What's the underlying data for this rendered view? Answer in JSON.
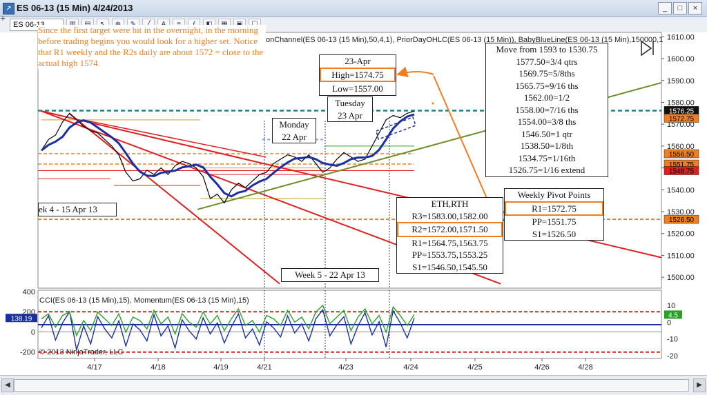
{
  "window": {
    "title": "ES 06-13 (15 Min)  4/24/2013",
    "minimize": "_",
    "maximize": "□",
    "close": "×",
    "restore": "❐"
  },
  "toolbar": {
    "instrument": "ES 06-13"
  },
  "indicator_label": "onChannel(ES 06-13 (15 Min),50,4,1), PriorDayOHLC(ES 06-13 (15 Min)), BabyBlueLine(ES 06-13 (15 Min),150000,1",
  "note": {
    "text": "Since the first target were hit in the overnight, in the morning before trading begins you would look for a higher set. Notice that R1 weekly and the R2s daily are about 1572 = close to the actual high 1574."
  },
  "box_23apr": {
    "date": "23-Apr",
    "high": "High=1574.75",
    "low": "Low=1557.00"
  },
  "box_tuesday": {
    "day": "Tuesday",
    "date": "23 Apr"
  },
  "box_monday": {
    "day": "Monday",
    "date": "22 Apr"
  },
  "box_week4": {
    "text": "ek 4 - 15 Apr 13"
  },
  "box_week5": {
    "text": "Week 5 - 22 Apr 13"
  },
  "box_move": {
    "title": "Move from 1593 to 1530.75",
    "rows": [
      "1577.50=3/4 qtrs",
      "1569.75=5/8ths",
      "1565.75=9/16 ths",
      "1562.00=1/2",
      "1558.00=7/16 ths",
      "1554.00=3/8 ths",
      "1546.50=1 qtr",
      "1538.50=1/8th",
      "1534.75=1/16th",
      "1526.75=1/16 extend"
    ]
  },
  "box_eth": {
    "title": "ETH,RTH",
    "rows": [
      "R3=1583.00,1582.00",
      "R2=1572.00,1571.50",
      "R1=1564.75,1563.75",
      "PP=1553.75,1553.25",
      "S1=1546.50,1545.50"
    ]
  },
  "box_weekly": {
    "title": "Weekly Pivot Points",
    "rows": [
      "R1=1572.75",
      "PP=1551.75",
      "S1=1526.50"
    ]
  },
  "indicator_title": "CCI(ES 06-13 (15 Min),15), Momentum(ES 06-13 (15 Min),15)",
  "copyright": "© 2013 NinjaTrader, LLC",
  "colors": {
    "price": "#000000",
    "channel": "#1a2fa0",
    "red": "#e02020",
    "orange": "#ef7e1f",
    "green": "#6d8f2a",
    "teal": "#1a8080",
    "cci": "#1a2fa0",
    "momentum": "#2aa02a"
  },
  "chart_data": {
    "type": "line",
    "instrument": "ES 06-13 (15 Min)",
    "price_axis": {
      "ticks": [
        "1610.00",
        "1600.00",
        "1590.00",
        "1580.00",
        "1570.00",
        "1560.00",
        "1550.00",
        "1540.00",
        "1530.00",
        "1520.00",
        "1510.00",
        "1500.00"
      ],
      "ylim": [
        1495,
        1612
      ]
    },
    "date_ticks": [
      "4/17",
      "4/18",
      "4/19",
      "4/21",
      "4/23",
      "4/24",
      "4/25",
      "4/26",
      "4/28"
    ],
    "price_markers": [
      {
        "label": "1576.25",
        "color": "#111111",
        "text_color": "#ffffff"
      },
      {
        "label": "1572.75",
        "color": "#ef7e1f",
        "text_color": "#000000"
      },
      {
        "label": "1556.50",
        "color": "#ef7e1f",
        "text_color": "#000000"
      },
      {
        "label": "1551.75",
        "color": "#ef7e1f",
        "text_color": "#000000"
      },
      {
        "label": "1548.75",
        "color": "#e02020",
        "text_color": "#000000"
      },
      {
        "label": "1526.50",
        "color": "#ef7e1f",
        "text_color": "#000000"
      }
    ],
    "price_series": [
      1558,
      1563,
      1565,
      1571,
      1575,
      1572,
      1569,
      1567,
      1566,
      1563,
      1560,
      1556,
      1548,
      1544,
      1545,
      1549,
      1547,
      1550,
      1547,
      1551,
      1553,
      1552,
      1550,
      1546,
      1536,
      1538,
      1534,
      1540,
      1543,
      1541,
      1544,
      1547,
      1548,
      1552,
      1554,
      1556,
      1555,
      1553,
      1556,
      1552,
      1548,
      1550,
      1554,
      1557,
      1555,
      1553,
      1554,
      1560,
      1566,
      1572,
      1574,
      1573,
      1575,
      1576
    ],
    "indicator_axis": {
      "left_ticks": [
        "400",
        "200",
        "0",
        "-200"
      ],
      "right_ticks": [
        "10",
        "0",
        "-10",
        "-20"
      ]
    },
    "indicator_markers": [
      {
        "label": "138.19"
      },
      {
        "label": "4.5"
      }
    ],
    "cci_series": [
      40,
      160,
      -80,
      90,
      200,
      -180,
      60,
      -120,
      150,
      30,
      -60,
      110,
      -140,
      80,
      20,
      -90,
      170,
      -40,
      60,
      -160,
      120,
      10,
      -70,
      140,
      -20,
      90,
      -110,
      50,
      180,
      -60,
      30,
      -130,
      100,
      40,
      -50,
      160,
      -10,
      80,
      -90,
      130,
      220,
      -40,
      70,
      150,
      -120,
      60,
      190,
      -30,
      100,
      -150,
      210,
      90,
      -60,
      138
    ],
    "momentum_series": [
      2,
      5,
      -3,
      4,
      6,
      -8,
      1,
      -5,
      6,
      2,
      -2,
      5,
      -6,
      3,
      1,
      -4,
      7,
      -1,
      3,
      -7,
      5,
      0,
      -3,
      6,
      -1,
      4,
      -5,
      2,
      8,
      -2,
      1,
      -6,
      4,
      2,
      -2,
      7,
      0,
      3,
      -4,
      6,
      10,
      -1,
      3,
      7,
      -5,
      3,
      8,
      -1,
      4,
      -6,
      9,
      4,
      -2,
      4.5
    ]
  }
}
